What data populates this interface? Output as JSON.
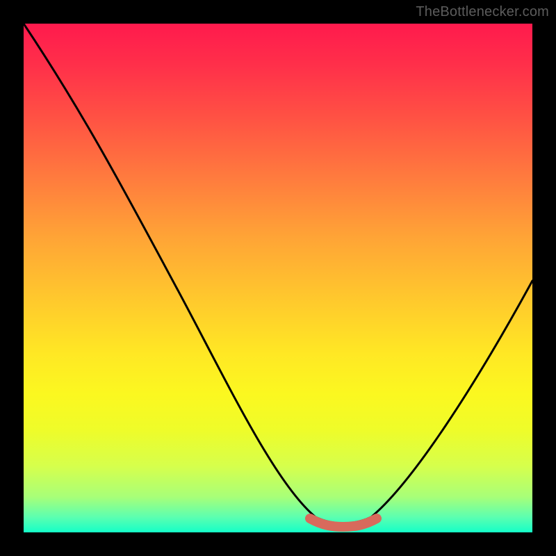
{
  "attribution": "TheBottlenecker.com",
  "chart_data": {
    "type": "line",
    "title": "",
    "xlabel": "",
    "ylabel": "",
    "xlim": [
      0,
      100
    ],
    "ylim": [
      0,
      100
    ],
    "series": [
      {
        "name": "curve",
        "x": [
          0,
          4,
          8,
          12,
          16,
          20,
          24,
          28,
          32,
          36,
          40,
          44,
          48,
          52,
          56,
          58,
          60,
          62,
          64,
          66,
          68,
          72,
          76,
          80,
          84,
          88,
          92,
          96,
          100
        ],
        "values": [
          100,
          95,
          89,
          83,
          77,
          70,
          63,
          56,
          49,
          42,
          35,
          28,
          21,
          14,
          8,
          5,
          3,
          1.5,
          1,
          1,
          1.5,
          4,
          8,
          14,
          20,
          27,
          34,
          42,
          49
        ]
      }
    ],
    "highlight_x_range": [
      56,
      68
    ],
    "gradient_stops": [
      {
        "pos": 0,
        "color": "#ff1a4d"
      },
      {
        "pos": 18,
        "color": "#ff5044"
      },
      {
        "pos": 42,
        "color": "#ffa436"
      },
      {
        "pos": 65,
        "color": "#ffe824"
      },
      {
        "pos": 87,
        "color": "#d6ff4c"
      },
      {
        "pos": 100,
        "color": "#14ffc8"
      }
    ]
  }
}
